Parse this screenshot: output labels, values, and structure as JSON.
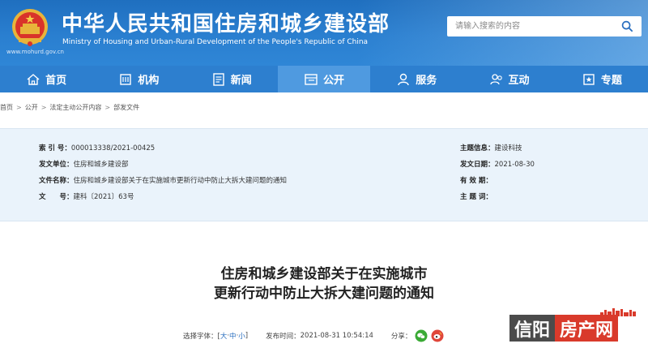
{
  "header": {
    "site_url": "www.mohurd.gov.cn",
    "title_cn": "中华人民共和国住房和城乡建设部",
    "title_en": "Ministry of Housing and Urban-Rural Development of the People's Republic of China",
    "search_placeholder": "请输入搜索的内容"
  },
  "nav": {
    "items": [
      {
        "label": "首页",
        "icon": "home-icon"
      },
      {
        "label": "机构",
        "icon": "building-icon"
      },
      {
        "label": "新闻",
        "icon": "news-icon"
      },
      {
        "label": "公开",
        "icon": "open-icon"
      },
      {
        "label": "服务",
        "icon": "service-icon"
      },
      {
        "label": "互动",
        "icon": "interact-icon"
      },
      {
        "label": "专题",
        "icon": "topic-icon"
      }
    ],
    "active": "公开"
  },
  "breadcrumb": [
    "首页",
    "公开",
    "法定主动公开内容",
    "部发文件"
  ],
  "info": {
    "index_label": "索 引 号：",
    "index_value": "000013338/2021-00425",
    "issuer_label": "发文单位：",
    "issuer_value": "住房和城乡建设部",
    "docname_label": "文件名称：",
    "docname_value": "住房和城乡建设部关于在实施城市更新行动中防止大拆大建问题的通知",
    "docno_label": "文　　号：",
    "docno_value": "建科〔2021〕63号",
    "topic_label": "主题信息：",
    "topic_value": "建设科技",
    "date_label": "发文日期：",
    "date_value": "2021-08-30",
    "valid_label": "有 效 期：",
    "valid_value": "",
    "keywords_label": "主 题 词：",
    "keywords_value": ""
  },
  "document": {
    "title_line1": "住房和城乡建设部关于在实施城市",
    "title_line2": "更新行动中防止大拆大建问题的通知"
  },
  "meta": {
    "font_label": "选择字体：[",
    "font_large": "大",
    "font_medium": "中",
    "font_small": "小",
    "font_end": "]",
    "publish_label": "发布时间：",
    "publish_value": "2021-08-31 10:54:14",
    "share_label": "分享："
  },
  "watermark": {
    "part1": "信阳",
    "part2": "房产网"
  },
  "colors": {
    "header_blue": "#1f6fbf",
    "nav_blue": "#2d7fcf",
    "nav_active": "#4f9ae0",
    "info_bg": "#eaf3fb",
    "wechat_green": "#3aaa35",
    "weibo_red": "#e0463a",
    "watermark_red": "#d93a2b"
  }
}
